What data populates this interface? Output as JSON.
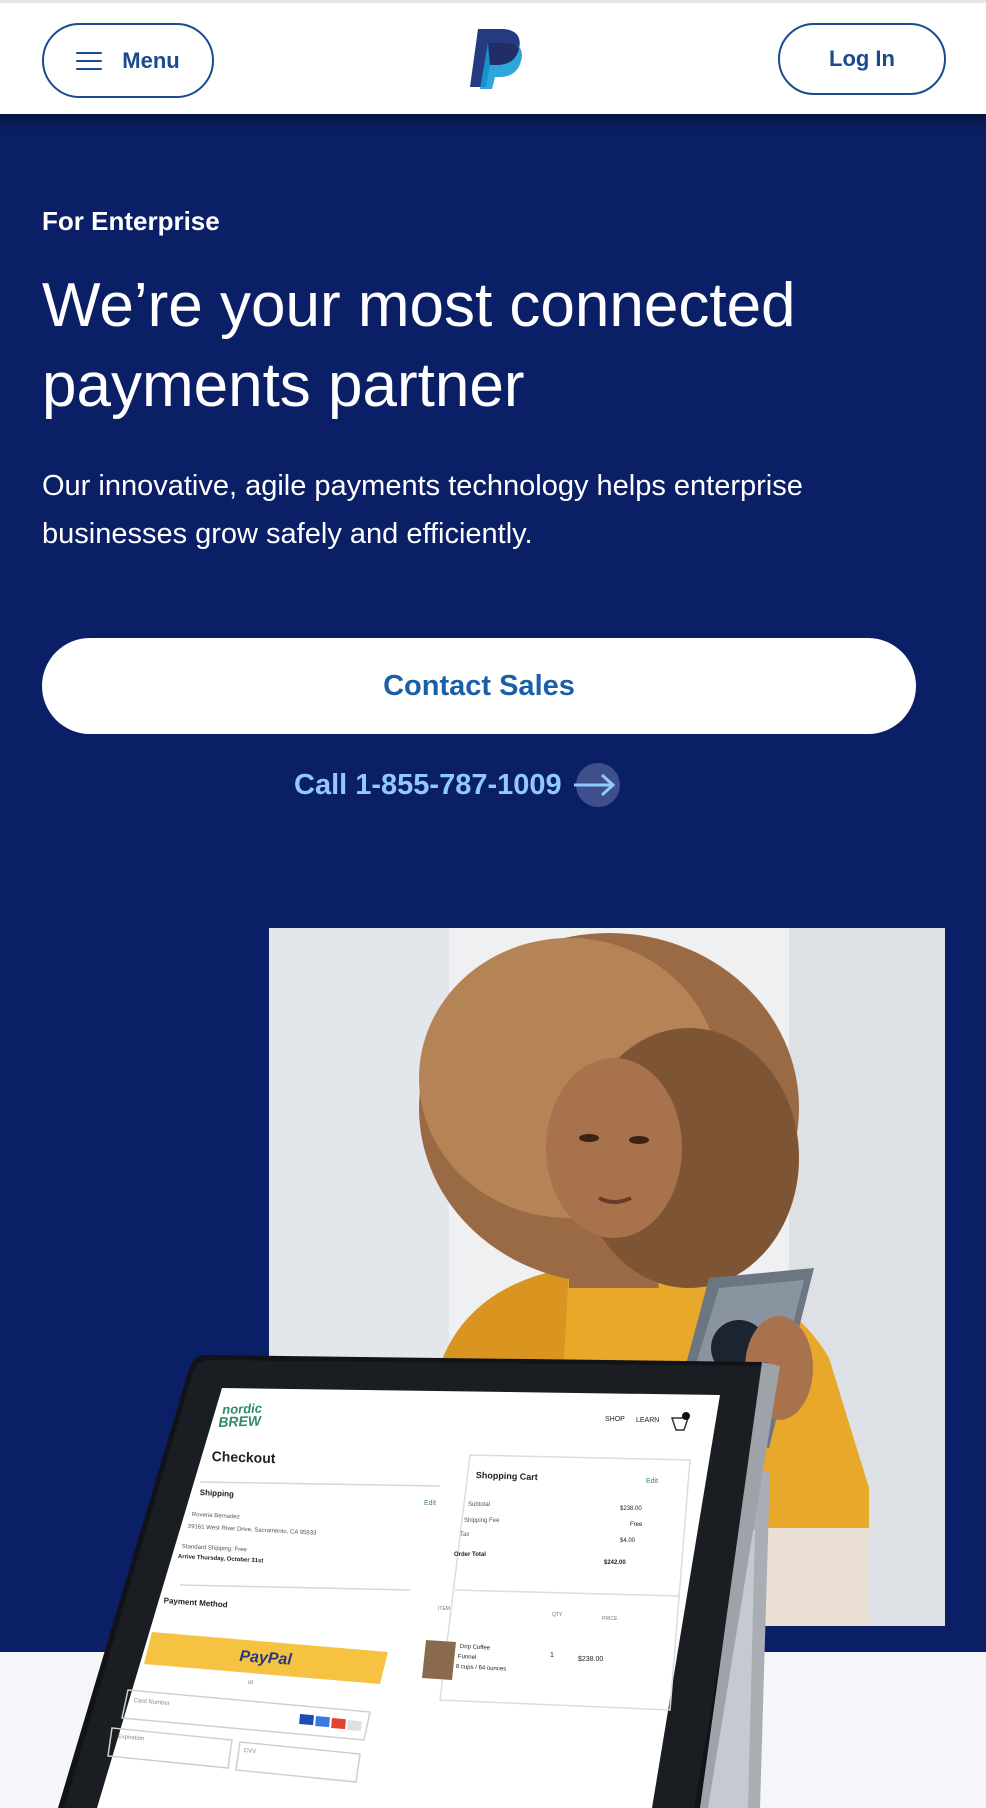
{
  "header": {
    "menu_label": "Menu",
    "login_label": "Log In",
    "logo": "paypal-logo"
  },
  "hero": {
    "eyebrow": "For Enterprise",
    "headline_line1": "We’re your most connected",
    "headline_line2": "payments partner",
    "subtext": "Our innovative, agile payments technology helps enterprise businesses grow safely and efficiently.",
    "cta_label": "Contact Sales",
    "call_label": "Call 1-855-787-1009"
  },
  "tablet_screen": {
    "brand_line1": "nordic",
    "brand_line2": "BREW",
    "nav_shop": "SHOP",
    "nav_learn": "LEARN",
    "checkout_title": "Checkout",
    "shipping_label": "Shipping",
    "edit_label": "Edit",
    "address_name": "Roveria Bernadez",
    "address_line": "29161 West River Drive, Sacramento, CA 95833",
    "shipping_method": "Standard Shipping: Free",
    "arrival": "Arrive Thursday, October 31st",
    "payment_method": "Payment Method",
    "paypal_button": "PayPal",
    "or_label": "or",
    "card_number": "Card Number",
    "expiration": "Expiration",
    "cvv": "CVV",
    "cart_title": "Shopping Cart",
    "cart_edit": "Edit",
    "subtotal_label": "Subtotal",
    "subtotal_value": "$238.00",
    "shipping_fee_label": "Shipping Fee",
    "shipping_fee_value": "Free",
    "tax_label": "Tax",
    "tax_value": "$4.00",
    "order_total_label": "Order Total",
    "order_total_value": "$242.00",
    "col_item": "ITEM",
    "col_qty": "QTY",
    "col_price": "PRICE",
    "item_name": "Drip Coffee",
    "item_name2": "Funnel",
    "item_desc": "8 cups / 64 ounces",
    "item_qty": "1",
    "item_price": "$238.00"
  },
  "colors": {
    "navy": "#0b1f66",
    "brand_blue": "#1b4a8f",
    "link_light_blue": "#8fc9ff",
    "paypal_yellow": "#f5c242"
  }
}
